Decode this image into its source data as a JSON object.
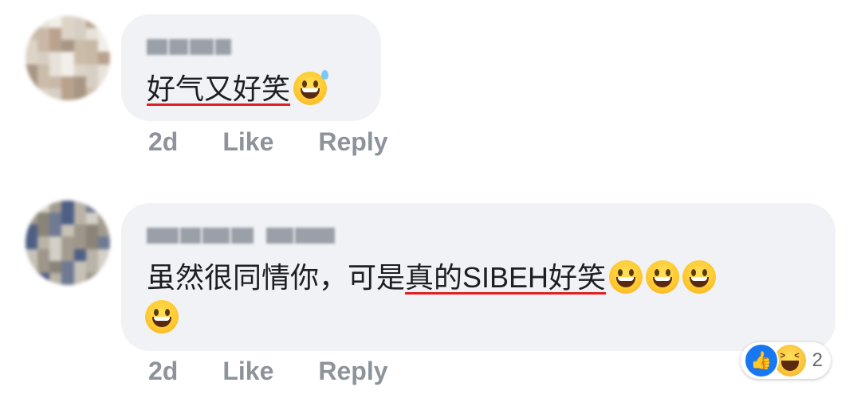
{
  "comments": [
    {
      "author": "一棵",
      "text_plain": "",
      "text_underlined": "好气又好笑",
      "emojis": [
        "grinning-sweat"
      ],
      "time": "2d",
      "like_label": "Like",
      "reply_label": "Reply"
    },
    {
      "author": "Pauline Chan",
      "text_plain": "虽然很同情你，可是",
      "text_underlined": "真的SIBEH好笑",
      "emojis": [
        "grinning",
        "grinning",
        "grinning",
        "grinning"
      ],
      "time": "2d",
      "like_label": "Like",
      "reply_label": "Reply",
      "reactions": {
        "types": [
          "like-icon",
          "haha-icon"
        ],
        "count": "2"
      }
    }
  ],
  "colors": {
    "bubble": "#f0f2f5",
    "meta": "#8d939a",
    "like": "#1877f2",
    "underline": "#e02020"
  }
}
